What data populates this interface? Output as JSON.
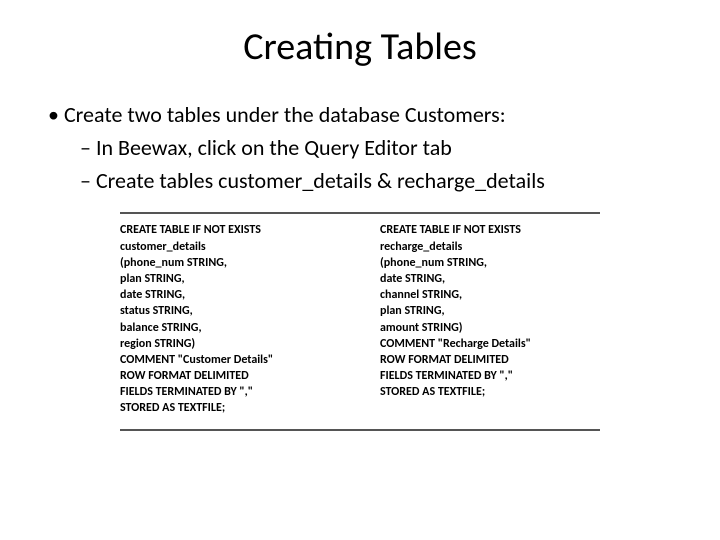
{
  "title": "Creating Tables",
  "bullets": {
    "item1": "Create two tables under the database Customers:",
    "sub1": "In Beewax, click on the Query Editor tab",
    "sub2": "Create tables customer_details & recharge_details"
  },
  "code_left": [
    {
      "t": "CREATE TABLE IF NOT EXISTS",
      "b": true
    },
    {
      "t": "customer_details",
      "b": true
    },
    {
      "t": "(phone_num STRING,",
      "b": true
    },
    {
      "t": "plan STRING,",
      "b": true
    },
    {
      "t": "date STRING,",
      "b": true
    },
    {
      "t": "status STRING,",
      "b": true
    },
    {
      "t": "balance STRING,",
      "b": true
    },
    {
      "t": "region STRING)",
      "b": true
    },
    {
      "t": "COMMENT \"Customer Details\"",
      "b": true
    },
    {
      "t": "ROW FORMAT DELIMITED",
      "b": true
    },
    {
      "t": "FIELDS TERMINATED BY \",\"",
      "b": true
    },
    {
      "t": "STORED AS TEXTFILE;",
      "b": true
    }
  ],
  "code_right": [
    {
      "t": "CREATE TABLE IF NOT EXISTS",
      "b": true
    },
    {
      "t": "recharge_details",
      "b": true
    },
    {
      "t": "(phone_num STRING,",
      "b": true
    },
    {
      "t": "date STRING,",
      "b": true
    },
    {
      "t": "channel STRING,",
      "b": true
    },
    {
      "t": "plan STRING,",
      "b": true
    },
    {
      "t": "amount STRING)",
      "b": true
    },
    {
      "t": "COMMENT \"Recharge Details\"",
      "b": true
    },
    {
      "t": "ROW FORMAT DELIMITED",
      "b": true
    },
    {
      "t": "FIELDS TERMINATED BY \",\"",
      "b": true
    },
    {
      "t": "STORED AS TEXTFILE;",
      "b": true
    }
  ]
}
